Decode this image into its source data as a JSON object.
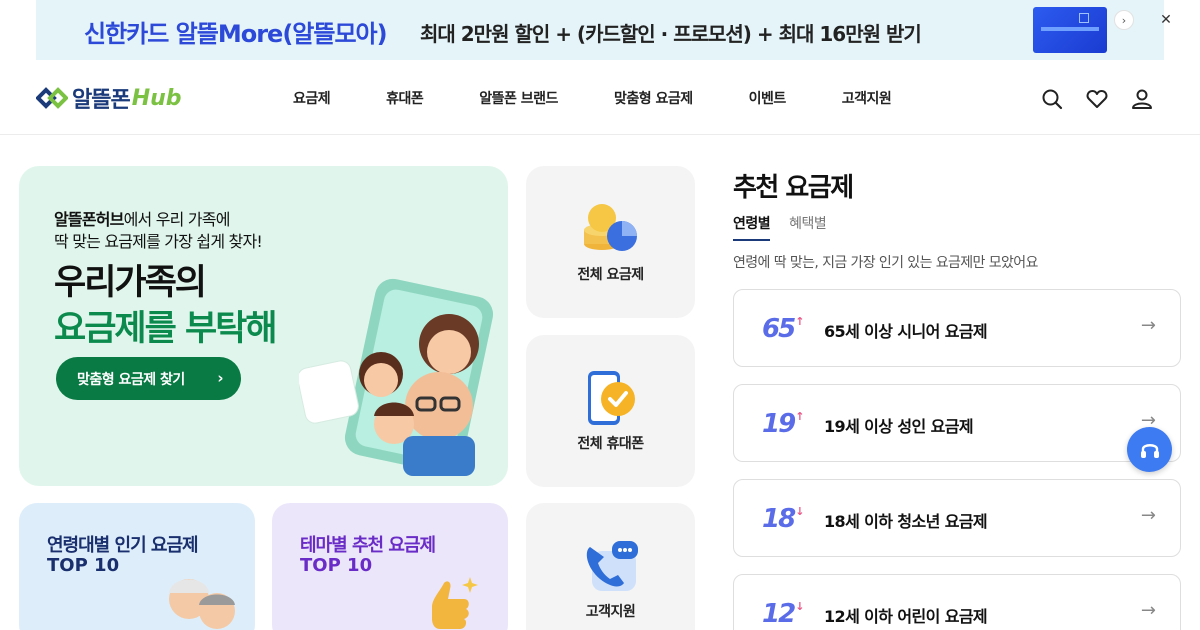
{
  "banner": {
    "brand_text": "신한카드 알뜰More(알뜰모아)",
    "promo_text": "최대 2만원 할인 + (카드할인 · 프로모션) + 최대 16만원 받기",
    "next_glyph": "›",
    "close_glyph": "✕",
    "brand_color": "#2c49d8"
  },
  "header": {
    "logo_text": "알뜰폰",
    "logo_hub": "Hub",
    "nav": [
      {
        "label": "요금제"
      },
      {
        "label": "휴대폰"
      },
      {
        "label": "알뜰폰 브랜드"
      },
      {
        "label": "맞춤형 요금제"
      },
      {
        "label": "이벤트"
      },
      {
        "label": "고객지원"
      }
    ],
    "icons": [
      "search-icon",
      "heart-icon",
      "user-icon"
    ]
  },
  "hero": {
    "sub_line1_bold": "알뜰폰허브",
    "sub_line1_rest": "에서 우리 가족에",
    "sub_line2": "딱 맞는 요금제를 가장 쉽게 찾자!",
    "title_line1": "우리가족의",
    "title_line2": "요금제를 부탁해",
    "button_label": "맞춤형 요금제 찾기",
    "button_chevron": "›",
    "accent": "#0c8a4d"
  },
  "tiles": [
    {
      "label": "전체 요금제",
      "icon": "coins-icon"
    },
    {
      "label": "전체 휴대폰",
      "icon": "phone-check-icon"
    },
    {
      "label": "고객지원",
      "icon": "support-phone-icon"
    }
  ],
  "promo_cards": [
    {
      "line1": "연령대별 인기 요금제",
      "line2": "TOP 10",
      "bg": "#ddeefa",
      "color": "#1a2f6e"
    },
    {
      "line1": "테마별 추천 요금제",
      "line2": "TOP 10",
      "bg": "#ece6fb",
      "color": "#6a2cc6"
    }
  ],
  "recommend": {
    "title": "추천 요금제",
    "tabs": [
      {
        "label": "연령별",
        "active": true
      },
      {
        "label": "혜택별",
        "active": false
      }
    ],
    "description": "연령에 딱 맞는, 지금 가장 인기 있는 요금제만 모았어요",
    "plans": [
      {
        "badge": "65",
        "arrow": "↑",
        "label": "65세 이상 시니어 요금제"
      },
      {
        "badge": "19",
        "arrow": "↑",
        "label": "19세 이상 성인 요금제"
      },
      {
        "badge": "18",
        "arrow": "↓",
        "label": "18세 이하 청소년 요금제"
      },
      {
        "badge": "12",
        "arrow": "↓",
        "label": "12세 이하 어린이 요금제"
      }
    ],
    "item_arrow": "→"
  }
}
